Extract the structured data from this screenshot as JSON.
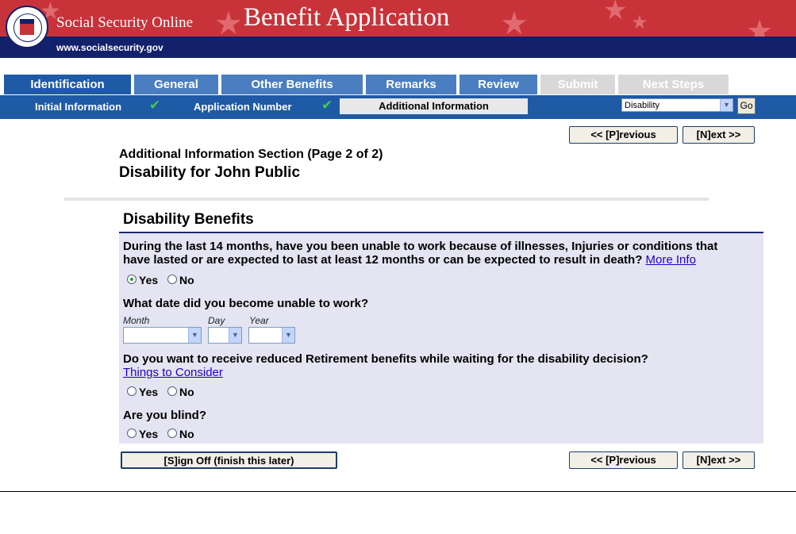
{
  "banner": {
    "brand": "Social Security Online",
    "title": "Benefit Application",
    "url": "www.socialsecurity.gov"
  },
  "tabs": [
    {
      "label": "Identification",
      "state": "active"
    },
    {
      "label": "General",
      "state": "enabled"
    },
    {
      "label": "Other Benefits",
      "state": "enabled"
    },
    {
      "label": "Remarks",
      "state": "enabled"
    },
    {
      "label": "Review",
      "state": "enabled"
    },
    {
      "label": "Submit",
      "state": "disabled"
    },
    {
      "label": "Next Steps",
      "state": "disabled"
    }
  ],
  "subnav": {
    "items": [
      "Initial Information",
      "Application Number",
      "Additional Information"
    ],
    "check": "✔",
    "select_value": "Disability",
    "go_label": "Go"
  },
  "nav": {
    "previous": "<< [P]revious",
    "next": "[N]ext >>",
    "sign_off": "[S]ign Off (finish this later)"
  },
  "page": {
    "section_heading": "Additional Information Section (Page 2 of 2)",
    "subtitle": "Disability for John Public"
  },
  "form": {
    "title": "Disability Benefits",
    "q1": {
      "line1": "During the last 14 months, have you been unable to work because of illnesses, Injuries or conditions that",
      "line2": "have lasted or are expected to last at least 12 months or can be expected to result in death?",
      "link": "More Info",
      "yes": "Yes",
      "no": "No",
      "selected": "Yes"
    },
    "q2": {
      "text": "What date did you become unable to work?",
      "month_label": "Month",
      "day_label": "Day",
      "year_label": "Year",
      "month_value": "",
      "day_value": "",
      "year_value": ""
    },
    "q3": {
      "text": "Do you want to receive reduced Retirement benefits while waiting for the disability decision?",
      "link": "Things to Consider",
      "yes": "Yes",
      "no": "No"
    },
    "q4": {
      "text": "Are you blind?",
      "yes": "Yes",
      "no": "No"
    }
  },
  "colors": {
    "banner_red": "#c8333a",
    "banner_navy": "#13206a",
    "tab_blue": "#4a7ec0",
    "active_tab": "#1f5aa6",
    "panel_bg": "#e4e4f2",
    "link": "#1f00c8"
  },
  "icons": [
    "seal-logo",
    "star-decoration",
    "checkmark-icon",
    "dropdown-arrow-icon"
  ]
}
